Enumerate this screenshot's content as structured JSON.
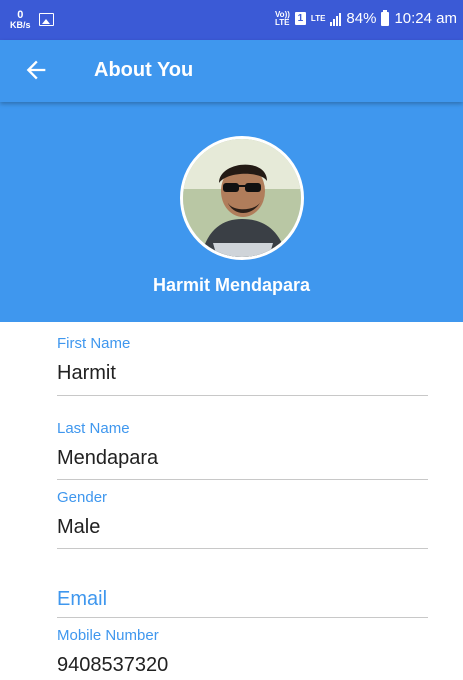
{
  "status": {
    "data_rate": "0",
    "data_unit": "KB/s",
    "volte": "Vo))",
    "lte_small": "LTE",
    "sim": "1",
    "lte2": "LTE",
    "battery": "84%",
    "time": "10:24 am"
  },
  "appbar": {
    "title": "About You",
    "back_icon": "arrow-back-icon"
  },
  "profile": {
    "full_name": "Harmit Mendapara"
  },
  "form": {
    "first_name": {
      "label": "First Name",
      "value": "Harmit"
    },
    "last_name": {
      "label": "Last Name",
      "value": "Mendapara"
    },
    "gender": {
      "label": "Gender",
      "value": "Male"
    },
    "email": {
      "label": "Email"
    },
    "mobile": {
      "label": "Mobile Number",
      "value": "9408537320"
    }
  },
  "colors": {
    "status_bar": "#3b5ad6",
    "primary": "#3f97ee",
    "divider": "#c8c8c8"
  }
}
